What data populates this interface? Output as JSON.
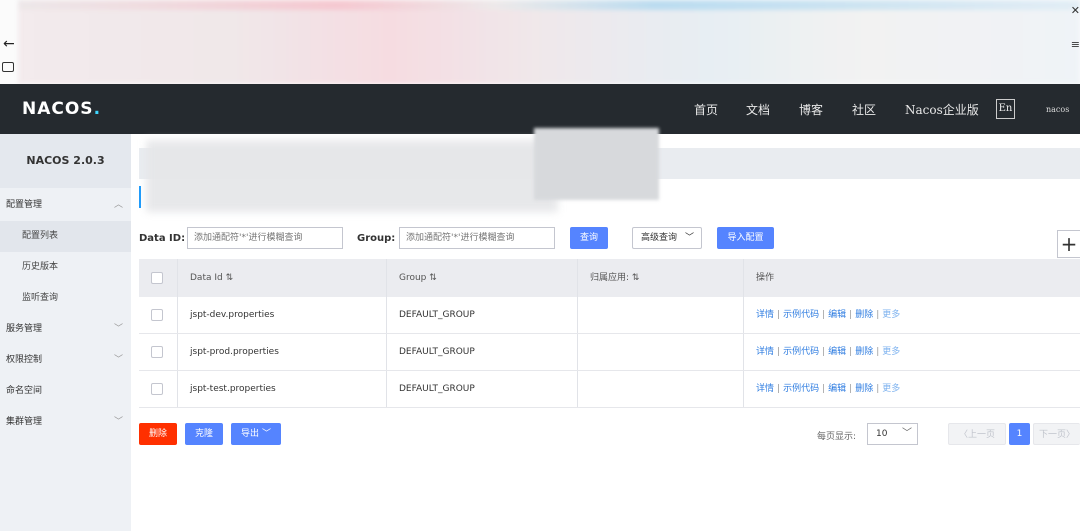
{
  "header": {
    "logo": "NACOS",
    "logo_dot": ".",
    "nav": [
      "首页",
      "文档",
      "博客",
      "社区",
      "Nacos企业版"
    ],
    "lang": "En",
    "user": "nacos"
  },
  "sidebar": {
    "version": "NACOS 2.0.3",
    "items": [
      {
        "label": "配置管理",
        "expanded": true
      },
      {
        "label": "配置列表",
        "sub": true,
        "active": true
      },
      {
        "label": "历史版本",
        "sub": true
      },
      {
        "label": "监听查询",
        "sub": true
      },
      {
        "label": "服务管理"
      },
      {
        "label": "权限控制"
      },
      {
        "label": "命名空间"
      },
      {
        "label": "集群管理"
      }
    ]
  },
  "search": {
    "data_id_label": "Data ID:",
    "data_id_placeholder": "添加通配符'*'进行模糊查询",
    "group_label": "Group:",
    "group_placeholder": "添加通配符'*'进行模糊查询",
    "query_button": "查询",
    "advanced_button": "高级查询",
    "import_button": "导入配置",
    "add_button": "+"
  },
  "table": {
    "columns": [
      "Data Id",
      "Group",
      "归属应用:",
      "操作"
    ],
    "rows": [
      {
        "data_id": "jspt-dev.properties",
        "group": "DEFAULT_GROUP",
        "app": ""
      },
      {
        "data_id": "jspt-prod.properties",
        "group": "DEFAULT_GROUP",
        "app": ""
      },
      {
        "data_id": "jspt-test.properties",
        "group": "DEFAULT_GROUP",
        "app": ""
      }
    ],
    "actions": [
      "详情",
      "示例代码",
      "编辑",
      "删除",
      "更多"
    ]
  },
  "footer": {
    "delete_button": "删除",
    "clone_button": "克隆",
    "export_button": "导出",
    "page_size_label": "每页显示:",
    "page_size": "10",
    "prev": "上一页",
    "current_page": "1",
    "next": "下一页"
  },
  "colors": {
    "primary": "#5584ff",
    "danger": "#ff3000",
    "header_bg": "#252a2f",
    "link": "#2f7de1"
  }
}
